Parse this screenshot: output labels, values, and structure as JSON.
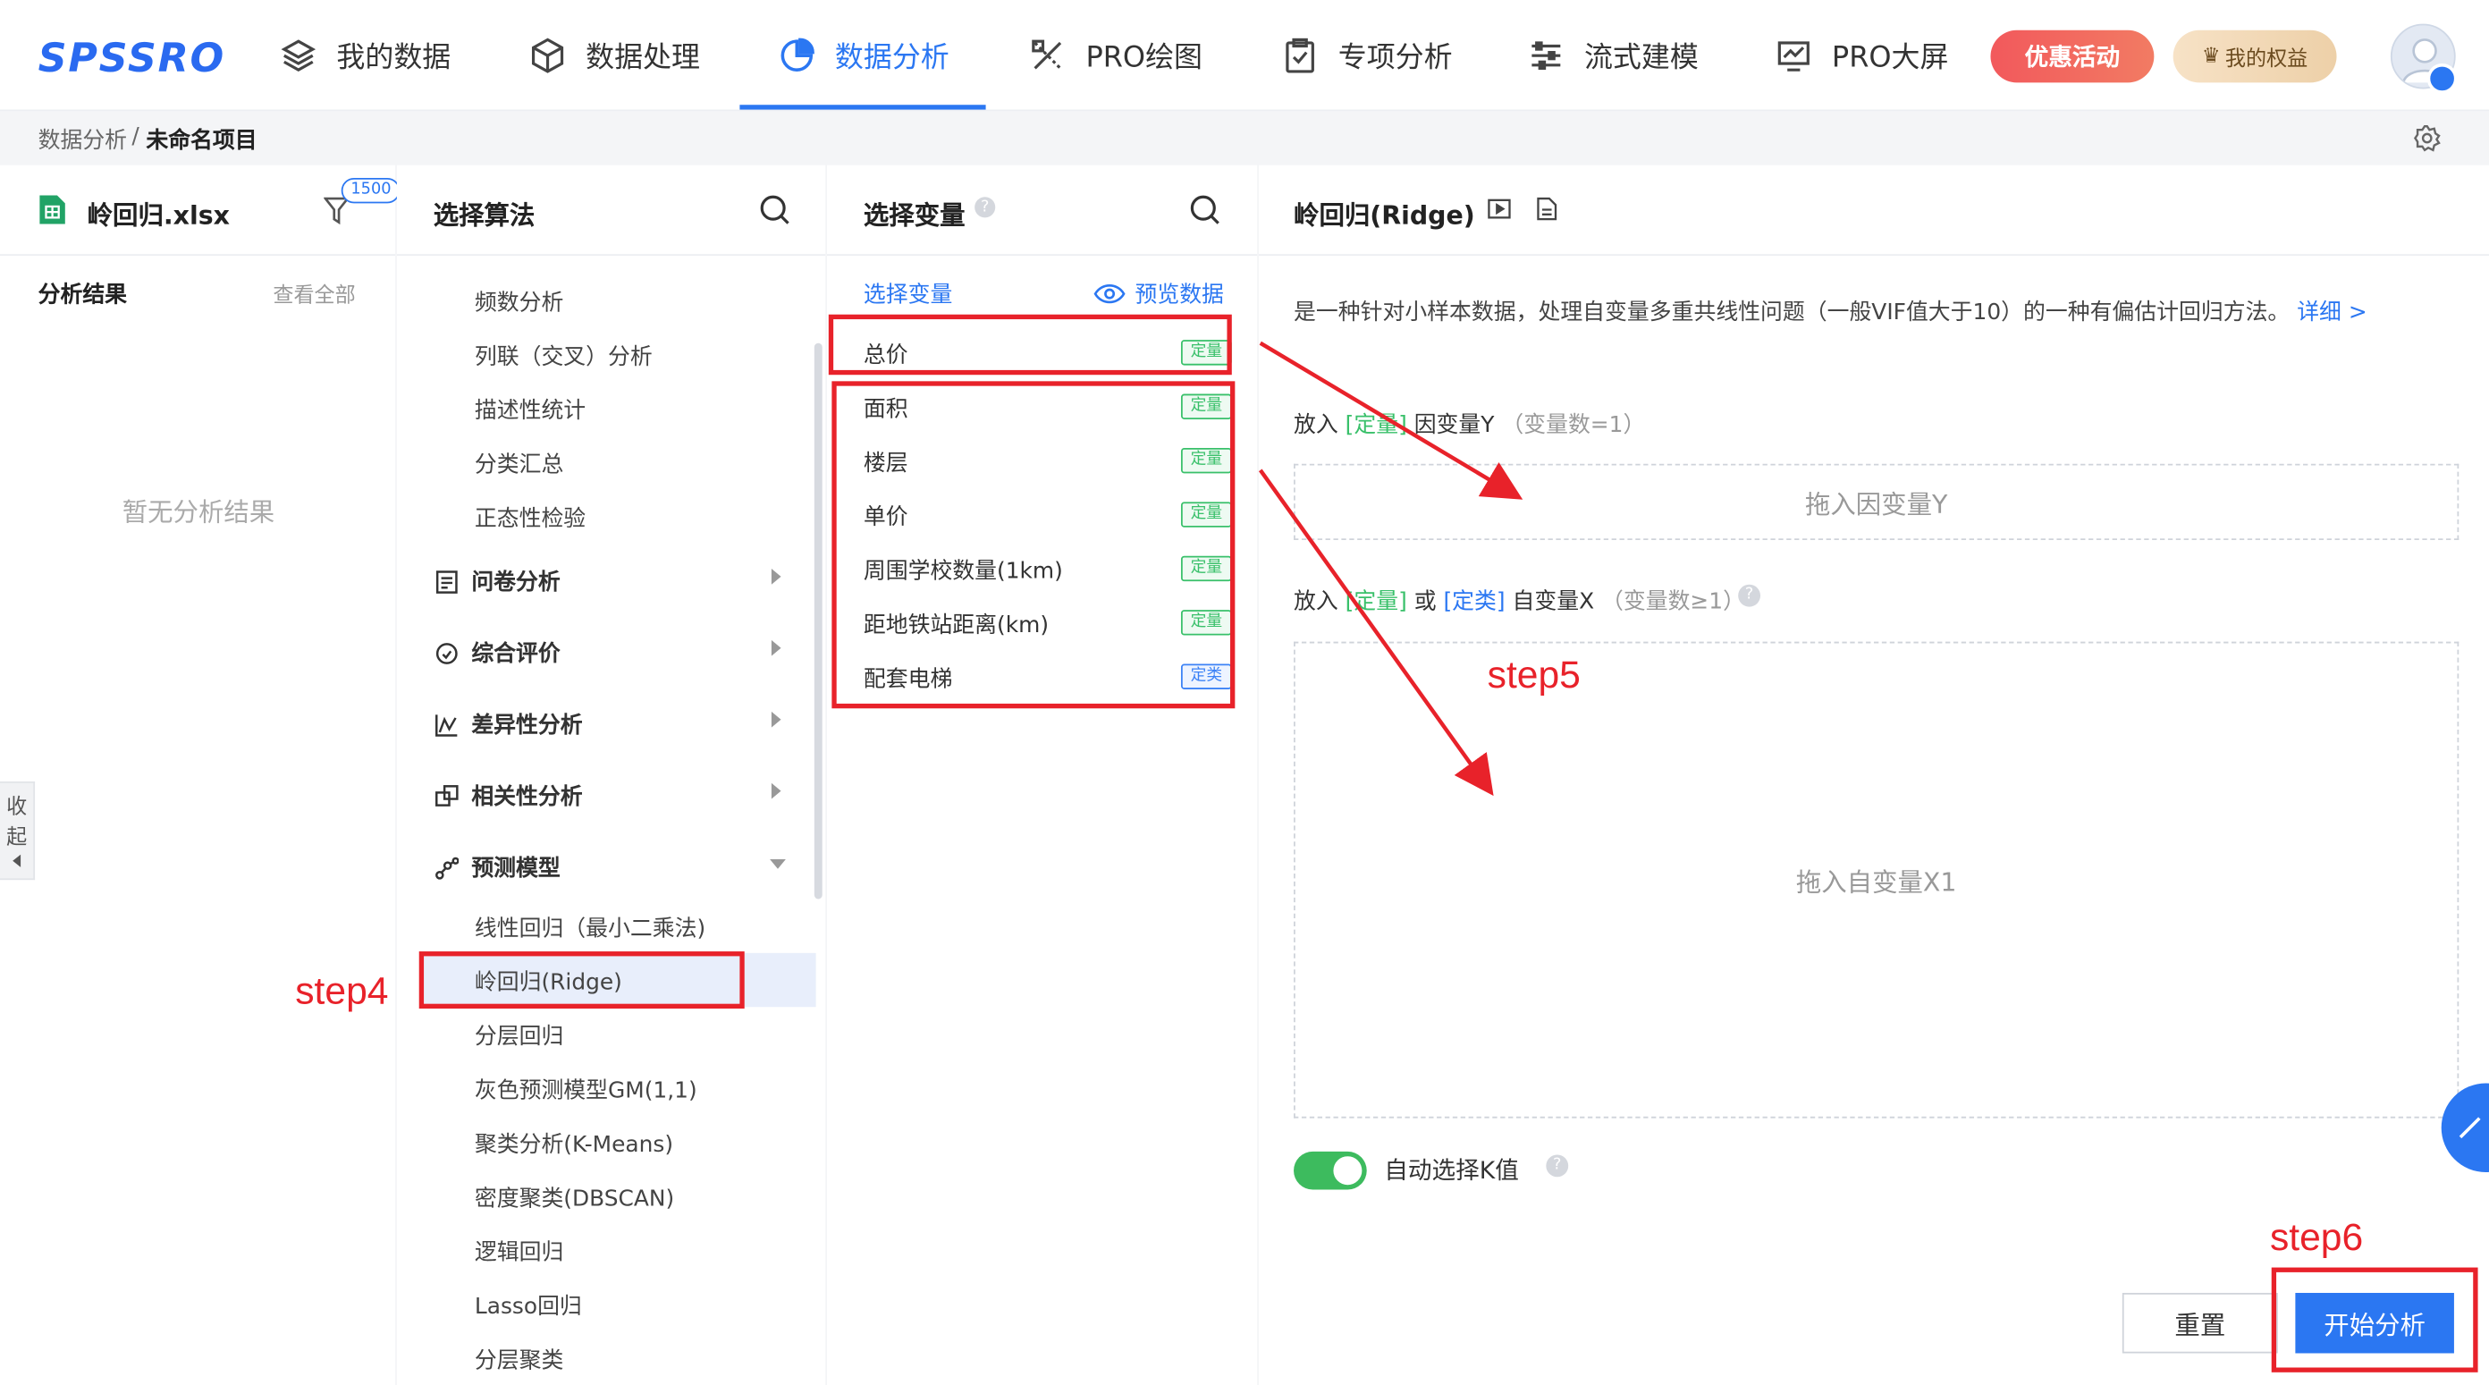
{
  "nav": {
    "logo": "SPSSRO",
    "items": [
      {
        "label": "我的数据"
      },
      {
        "label": "数据处理"
      },
      {
        "label": "数据分析"
      },
      {
        "label": "PRO绘图"
      },
      {
        "label": "专项分析"
      },
      {
        "label": "流式建模"
      },
      {
        "label": "PRO大屏"
      }
    ],
    "promo": "优惠活动",
    "rights": "我的权益"
  },
  "breadcrumb": {
    "parent": "数据分析",
    "sep": "/",
    "current": "未命名项目"
  },
  "file_panel": {
    "filename": "岭回归.xlsx",
    "badge": "1500",
    "results_title": "分析结果",
    "view_all": "查看全部",
    "empty": "暂无分析结果",
    "collapse": [
      "收",
      "起"
    ]
  },
  "alg_panel": {
    "title": "选择算法",
    "basic_items": [
      "频数分析",
      "列联（交叉）分析",
      "描述性统计",
      "分类汇总",
      "正态性检验"
    ],
    "groups": [
      "问卷分析",
      "综合评价",
      "差异性分析",
      "相关性分析",
      "预测模型"
    ],
    "predict_items": [
      "线性回归（最小二乘法)",
      "岭回归(Ridge)",
      "分层回归",
      "灰色预测模型GM(1,1)",
      "聚类分析(K-Means)",
      "密度聚类(DBSCAN)",
      "逻辑回归",
      "Lasso回归",
      "分层聚类"
    ]
  },
  "var_panel": {
    "title": "选择变量",
    "subtitle": "选择变量",
    "preview": "预览数据",
    "variables": [
      {
        "name": "总价",
        "tag": "定量"
      },
      {
        "name": "面积",
        "tag": "定量"
      },
      {
        "name": "楼层",
        "tag": "定量"
      },
      {
        "name": "单价",
        "tag": "定量"
      },
      {
        "name": "周围学校数量(1km)",
        "tag": "定量"
      },
      {
        "name": "距地铁站距离(km)",
        "tag": "定量"
      },
      {
        "name": "配套电梯",
        "tag": "定类"
      }
    ]
  },
  "main_panel": {
    "title": "岭回归(Ridge)",
    "desc": "是一种针对小样本数据，处理自变量多重共线性问题（一般VIF值大于10）的一种有偏估计回归方法。",
    "detail_link": "详细 >",
    "y_label_pre": "放入",
    "y_label_tag": "[定量]",
    "y_label_post": "因变量Y",
    "y_count": "（变量数=1）",
    "y_drop": "拖入因变量Y",
    "x_label_pre": "放入",
    "x_label_tag1": "[定量]",
    "x_label_or": "或",
    "x_label_tag2": "[定类]",
    "x_label_post": "自变量X",
    "x_count": "（变量数≥1）",
    "x_drop": "拖入自变量X1",
    "auto_k": "自动选择K值",
    "reset": "重置",
    "start": "开始分析"
  },
  "annotations": {
    "step4": "step4",
    "step5": "step5",
    "step6": "step6"
  }
}
